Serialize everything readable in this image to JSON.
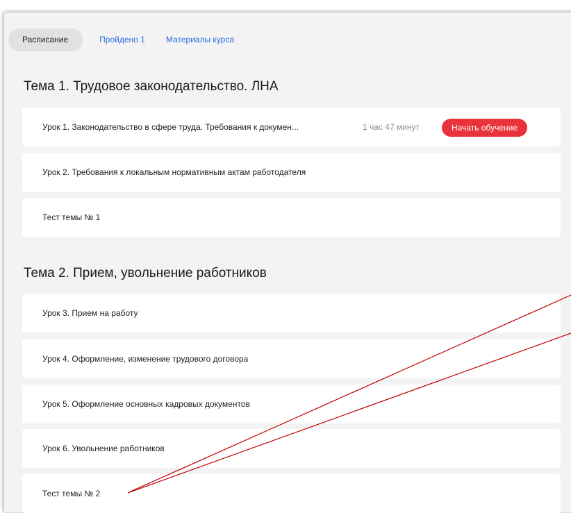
{
  "tabs": [
    {
      "label": "Расписание",
      "active": true
    },
    {
      "label": "Пройдено 1",
      "active": false
    },
    {
      "label": "Материалы курса",
      "active": false
    }
  ],
  "sections": [
    {
      "title": "Тема 1. Трудовое законодательство. ЛНА",
      "items": [
        {
          "title": "Урок 1. Законодательство в сфере труда. Требования к докумен...",
          "duration": "1 час 47 минут",
          "button": "Начать обучение"
        },
        {
          "title": "Урок 2. Требования к локальным нормативным актам работодателя"
        },
        {
          "title": "Тест темы № 1"
        }
      ]
    },
    {
      "title": "Тема 2. Прием, увольнение работников",
      "items": [
        {
          "title": "Урок 3. Прием на работу"
        },
        {
          "title": "Урок 4. Оформление, изменение трудового договора"
        },
        {
          "title": "Урок 5. Оформление основных кадровых документов"
        },
        {
          "title": "Урок 6. Увольнение работников"
        },
        {
          "title": "Тест темы № 2"
        }
      ]
    }
  ],
  "colors": {
    "accent": "#e8333a",
    "link": "#2b6de0",
    "page_bg": "#f3f3f3",
    "annotation": "#c00000"
  }
}
